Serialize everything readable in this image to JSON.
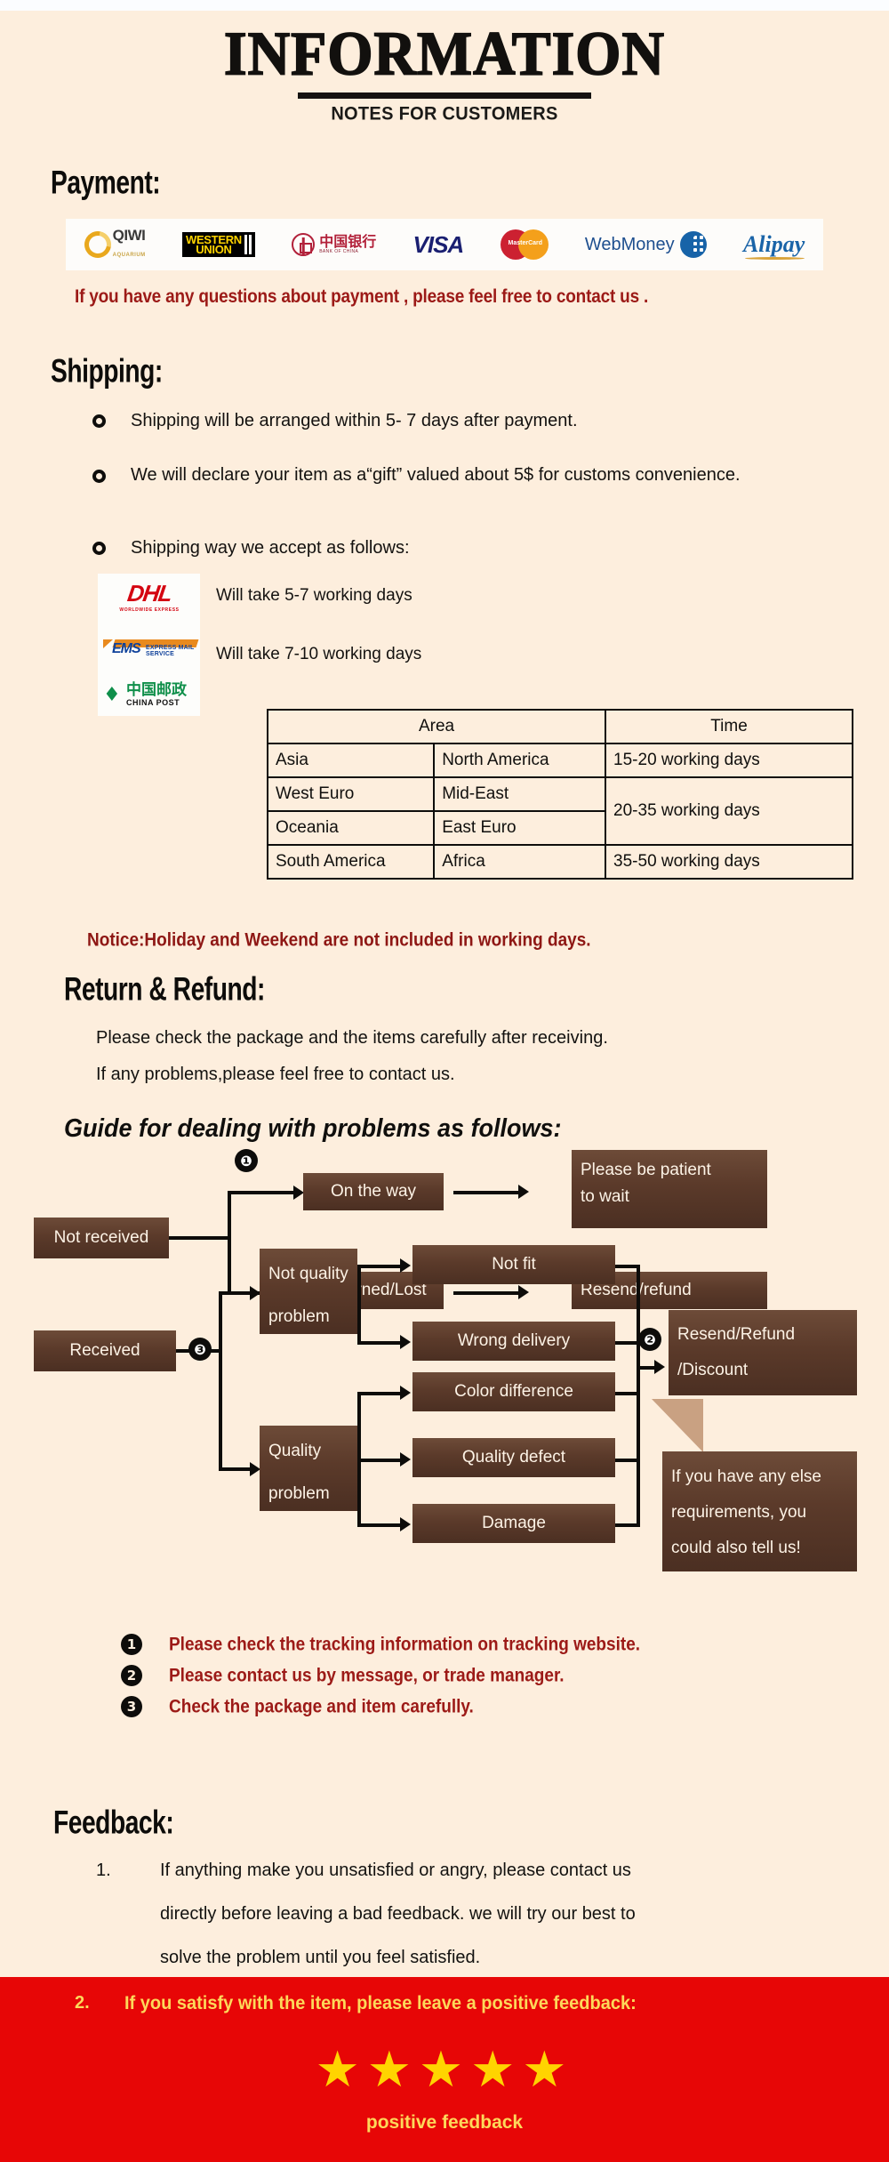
{
  "header": {
    "title": "INFORMATION",
    "subtitle": "NOTES FOR CUSTOMERS"
  },
  "payment": {
    "heading": "Payment:",
    "methods": [
      {
        "name": "qiwi-logo",
        "label": "QIWI",
        "sub": "AQUARIUM"
      },
      {
        "name": "western-union-logo",
        "label1": "WESTERN",
        "label2": "UNION"
      },
      {
        "name": "bank-of-china-logo",
        "cn": "中国银行",
        "en": "BANK OF CHINA"
      },
      {
        "name": "visa-logo",
        "label": "VISA"
      },
      {
        "name": "mastercard-logo",
        "label": "MasterCard"
      },
      {
        "name": "webmoney-logo",
        "label": "WebMoney"
      },
      {
        "name": "alipay-logo",
        "label": "Alipay"
      }
    ],
    "note": "If you have any questions about payment , please feel free to contact us ."
  },
  "shipping": {
    "heading": "Shipping:",
    "bullets": [
      "Shipping will be arranged within  5- 7  days after payment.",
      "We will declare your item as a“gift” valued about 5$ for customs convenience.",
      "Shipping way we accept as follows:"
    ],
    "carriers": [
      {
        "logo_name": "dhl-logo",
        "label": "DHL",
        "sub": "WORLDWIDE EXPRESS",
        "note": "Will take 5-7 working days"
      },
      {
        "logo_name": "ems-logo",
        "label": "EMS",
        "sub": "EXPRESS MAIL SERVICE",
        "note": "Will take 7-10 working days"
      },
      {
        "logo_name": "china-post-logo",
        "cn": "中国邮政",
        "en": "CHINA  POST",
        "note": ""
      }
    ],
    "table": {
      "headers": [
        "Area",
        "Time"
      ],
      "rows": [
        {
          "a": "Asia",
          "b": "North America",
          "time": "15-20 working days"
        },
        {
          "a": "West Euro",
          "b": "Mid-East",
          "time": "20-35 working days"
        },
        {
          "a": "Oceania",
          "b": "East Euro",
          "time": ""
        },
        {
          "a": "South America",
          "b": "Africa",
          "time": "35-50 working days"
        }
      ]
    },
    "notice": "Notice:Holiday and Weekend are not included in working days."
  },
  "return_refund": {
    "heading": "Return & Refund:",
    "lines": [
      "Please check the package and the items carefully after receiving.",
      "If any problems,please feel free to contact us."
    ],
    "guide_heading": "Guide for dealing with problems as follows:"
  },
  "flowchart": {
    "not_received": "Not received",
    "on_the_way": "On the way",
    "returned_lost": "Returned/Lost",
    "please_be_patient_1": "Please be patient",
    "please_be_patient_2": "to wait",
    "resend_refund": "Resend/refund",
    "received": "Received",
    "not_quality_1": "Not quality",
    "not_quality_2": "problem",
    "quality_1": "Quality",
    "quality_2": "problem",
    "not_fit": "Not fit",
    "wrong_delivery": "Wrong delivery",
    "color_difference": "Color difference",
    "quality_defect": "Quality defect",
    "damage": "Damage",
    "resend_refund_discount_1": "Resend/Refund",
    "resend_refund_discount_2": "/Discount",
    "callout_1": "If you have any else",
    "callout_2": "requirements, you",
    "callout_3": "could also tell us!",
    "marker_1": "❶",
    "marker_2": "❷",
    "marker_3": "❸"
  },
  "notes": [
    {
      "num": "1",
      "text": "Please check the tracking information on tracking website."
    },
    {
      "num": "2",
      "text": "Please contact us by message, or trade manager."
    },
    {
      "num": "3",
      "text": "Check the package and item carefully."
    }
  ],
  "feedback": {
    "heading": "Feedback:",
    "item1_num": "1.",
    "item1_lines": [
      "If anything make you unsatisfied or angry, please contact us",
      "directly before leaving a bad feedback. we will try our best to",
      "solve the problem until  you feel satisfied."
    ],
    "item2_num": "2.",
    "item2_text": "If you satisfy with the item, please leave a positive feedback:",
    "stars": "★★★★★",
    "positive_label": "positive feedback"
  },
  "colors": {
    "background": "#fdeedd",
    "accent_red": "#9c1a17",
    "band_red": "#e70606",
    "box_brown": "#5b3a2a",
    "star_yellow": "#ffd400",
    "gold_text": "#fdd85a"
  }
}
